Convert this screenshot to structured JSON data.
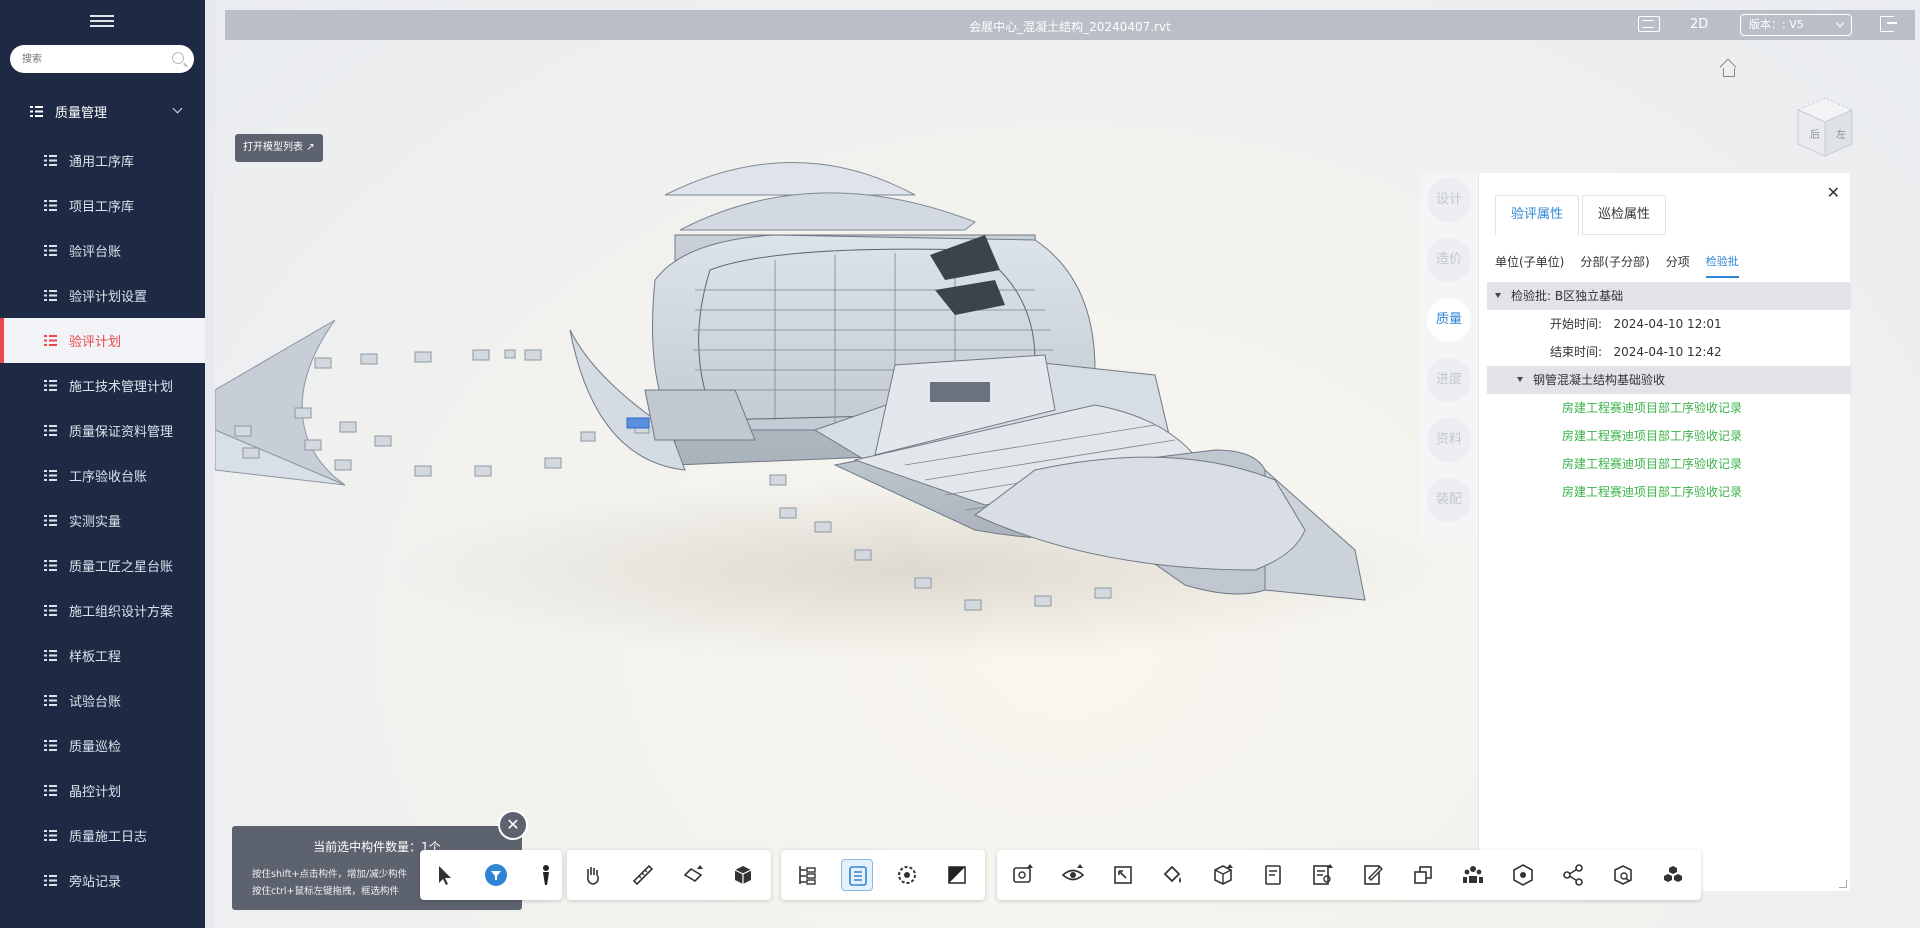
{
  "sidebar": {
    "search_placeholder": "搜索",
    "group_label": "质量管理",
    "items": [
      {
        "label": "通用工序库"
      },
      {
        "label": "项目工序库"
      },
      {
        "label": "验评台账"
      },
      {
        "label": "验评计划设置"
      },
      {
        "label": "验评计划",
        "active": true
      },
      {
        "label": "施工技术管理计划"
      },
      {
        "label": "质量保证资料管理"
      },
      {
        "label": "工序验收台账"
      },
      {
        "label": "实测实量"
      },
      {
        "label": "质量工匠之星台账"
      },
      {
        "label": "施工组织设计方案"
      },
      {
        "label": "样板工程"
      },
      {
        "label": "试验台账"
      },
      {
        "label": "质量巡检"
      },
      {
        "label": "晶控计划"
      },
      {
        "label": "质量施工日志"
      },
      {
        "label": "旁站记录"
      }
    ]
  },
  "topbar": {
    "title": "会展中心_混凝土结构_20240407.rvt",
    "mode_label": "2D",
    "version_label": "版本：: V5"
  },
  "viewer": {
    "open_model_list": "打开模型列表",
    "view_cube_faces": [
      "后",
      "左"
    ]
  },
  "side_tabs": [
    "设计",
    "造价",
    "质量",
    "进度",
    "资料",
    "装配"
  ],
  "panel": {
    "tabs": [
      "验评属性",
      "巡检属性"
    ],
    "crumbs": [
      "单位(子单位)",
      "分部(子分部)",
      "分项",
      "检验批"
    ],
    "batch_label": "检验批:  B区独立基础",
    "start_label": "开始时间:",
    "start_value": "2024-04-10 12:01",
    "end_label": "结束时间:",
    "end_value": "2024-04-10 12:42",
    "subgroup_label": "钢管混凝土结构基础验收",
    "records": [
      "房建工程赛迪项目部工序验收记录",
      "房建工程赛迪项目部工序验收记录",
      "房建工程赛迪项目部工序验收记录",
      "房建工程赛迪项目部工序验收记录"
    ]
  },
  "selection": {
    "count_text": "当前选中构件数量：1个",
    "hint1": "按住shift+点击构件，增加/减少构件",
    "hint2": "按住ctrl+鼠标左键拖拽，框选构件"
  },
  "toolbar": {
    "groups": [
      [
        "select-arrow-icon",
        "filter-icon",
        "person-icon"
      ],
      [
        "hand-pan-icon",
        "ruler-icon",
        "section-plane-icon",
        "cube-icon"
      ],
      [
        "tree-icon",
        "properties-icon",
        "settings-gear-icon",
        "fill-toggle-icon"
      ],
      [
        "measure-area-icon",
        "visibility-icon",
        "fit-view-icon",
        "paint-bucket-icon",
        "model-box-icon",
        "document-icon",
        "search-list-icon",
        "markup-icon",
        "copy-icon",
        "users-icon",
        "component-icon",
        "share-icon",
        "box-search-icon",
        "cluster-icon"
      ]
    ]
  },
  "colors": {
    "sidebar_bg": "#1e2a44",
    "active_red": "#e5484d",
    "accent_blue": "#2f86d6",
    "link_green": "#3cb14a",
    "topbar_bg": "#b9bec7"
  }
}
